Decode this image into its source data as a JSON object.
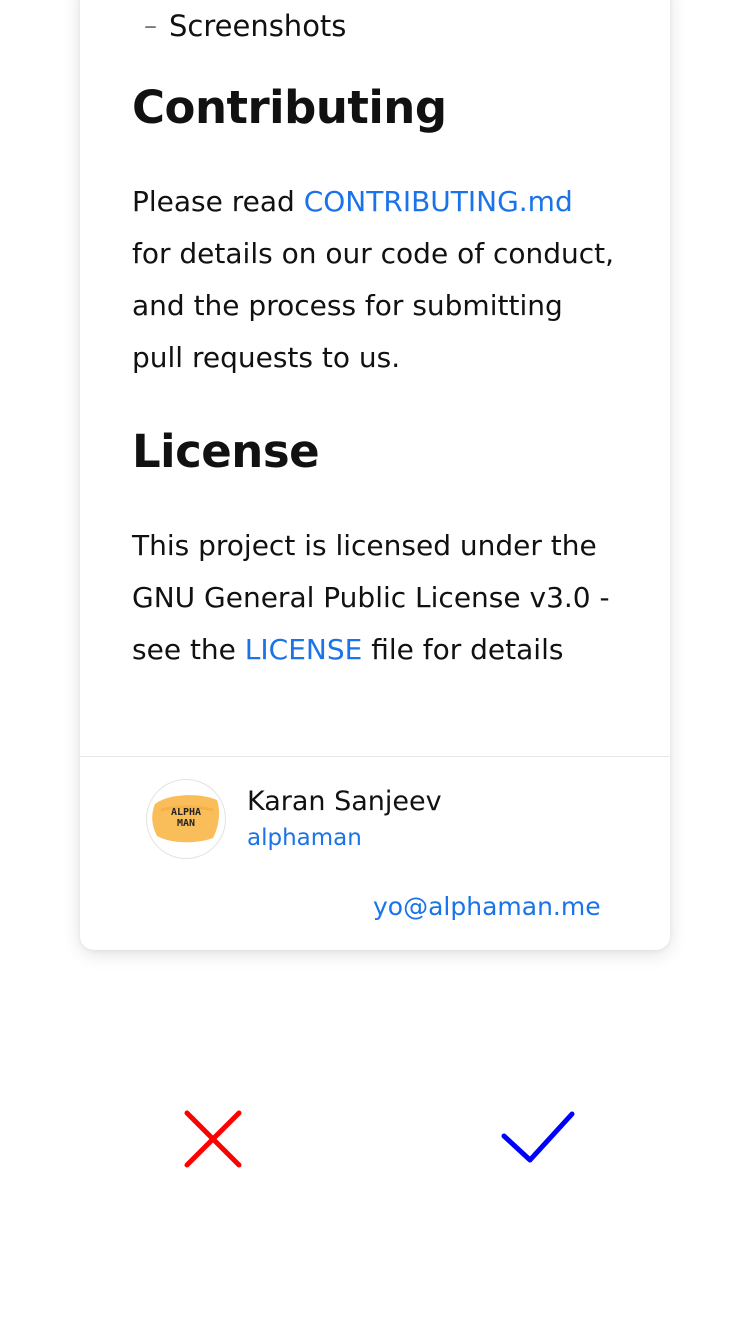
{
  "readme": {
    "list_item": "Screenshots",
    "contributing": {
      "heading": "Contributing",
      "text_before": "Please read ",
      "link": "CONTRIBUTING.md",
      "line2": "for details on our code of conduct,",
      "line3": "and the process for submitting",
      "line4": "pull requests to us."
    },
    "license": {
      "heading": "License",
      "line1": "This project is licensed under the",
      "line2": "GNU General Public License v3.0 -",
      "text_before": "see the ",
      "link": "LICENSE",
      "text_after": " file for details"
    }
  },
  "author": {
    "name": "Karan Sanjeev",
    "handle": "alphaman",
    "email": "yo@alphaman.me",
    "avatar_text_line1": "ALPHA",
    "avatar_text_line2": "MAN"
  },
  "actions": {
    "reject_icon": "close-icon",
    "accept_icon": "checkmark-icon",
    "reject_color": "#ff0000",
    "accept_color": "#0000ff"
  },
  "colors": {
    "link": "#1a73e8",
    "avatar_bg": "#f9bd5a"
  }
}
